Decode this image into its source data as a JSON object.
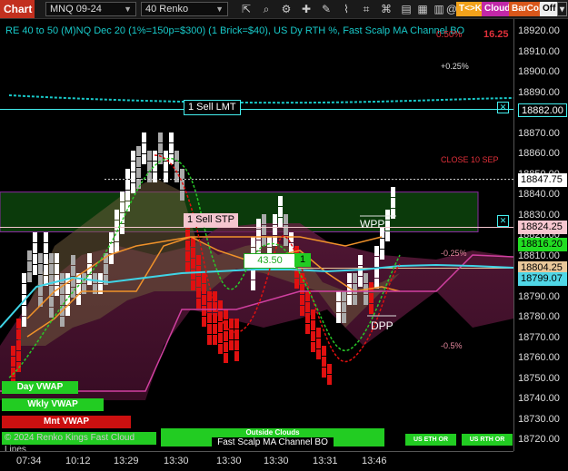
{
  "toolbar": {
    "chart_tab": "Chart",
    "instrument": "MNQ 09-24",
    "bar_type": "40 Renko",
    "tk_button": "T<>K",
    "cloud_button": "Cloud",
    "barcol_button": "BarCol",
    "off_button": "Off",
    "icons": [
      "cursor-icon",
      "zoom-icon",
      "bar-style-icon",
      "crosshair-icon",
      "draw-icon",
      "indicator-icon",
      "strategy-icon",
      "properties-icon",
      "template-icon",
      "data-box-icon",
      "chart-trader-icon",
      "at-icon"
    ]
  },
  "title": "RE 40 to 50 (M)NQ Dec 20 (1%=150p=$300) (1 Brick=$40), US Dy RTH %, Fast Scalp MA Channel BO",
  "annotations": {
    "pct_top": "0.50%",
    "pct_top_val": "16.25",
    "pct_quarter": "+0.25%",
    "close_label": "CLOSE 10 SEP",
    "wpp": "WPP",
    "dpp": "DPP",
    "pct_neg_quarter": "-0.25%",
    "pct_neg_half": "-0.5%"
  },
  "orders": {
    "sell_limit": "1 Sell LMT",
    "sell_stop": "1 Sell STP",
    "position_price": "43.50",
    "position_qty": "1"
  },
  "left_labels": {
    "day_vwap": "Day VWAP",
    "weekly_vwap": "Wkly VWAP",
    "month_vwap": "Mnt VWAP",
    "copyright": "© 2024 Renko Kings Fast Cloud Lines",
    "fast_scalp": "Fast Scalp MA Channel BO",
    "outside_clouds": "Outside Clouds",
    "us_eth_or": "US ETH OR",
    "us_rth_or": "US RTH OR"
  },
  "price_axis": {
    "ticks": [
      "18920.00",
      "18910.00",
      "18900.00",
      "18890.00",
      "18880.00",
      "18870.00",
      "18860.00",
      "18850.00",
      "18840.00",
      "18830.00",
      "18820.00",
      "18810.00",
      "18800.00",
      "18790.00",
      "18780.00",
      "18770.00",
      "18760.00",
      "18750.00",
      "18740.00",
      "18730.00",
      "18720.00"
    ],
    "tags": [
      {
        "value": "18882.00",
        "bg": "#000000",
        "fg": "#ffffff"
      },
      {
        "value": "18847.75",
        "bg": "#ffffff",
        "fg": "#000000"
      },
      {
        "value": "18824.25",
        "bg": "#f5c6cf",
        "fg": "#000000"
      },
      {
        "value": "18816.20",
        "bg": "#22dd22",
        "fg": "#000000"
      },
      {
        "value": "18804.25",
        "bg": "#e8c79a",
        "fg": "#000000"
      },
      {
        "value": "18799.07",
        "bg": "#4fd6e6",
        "fg": "#000000"
      }
    ]
  },
  "time_axis": [
    "07:34",
    "10:12",
    "13:29",
    "13:30",
    "13:30",
    "13:30",
    "13:31",
    "13:46"
  ],
  "colors": {
    "accent": "#c2301f",
    "cyan": "#18c9c9",
    "green_zone": "#0b3a0b",
    "up_brick": "#ffffff",
    "down_brick": "#e01010",
    "cloud": "#5a1a3a"
  }
}
